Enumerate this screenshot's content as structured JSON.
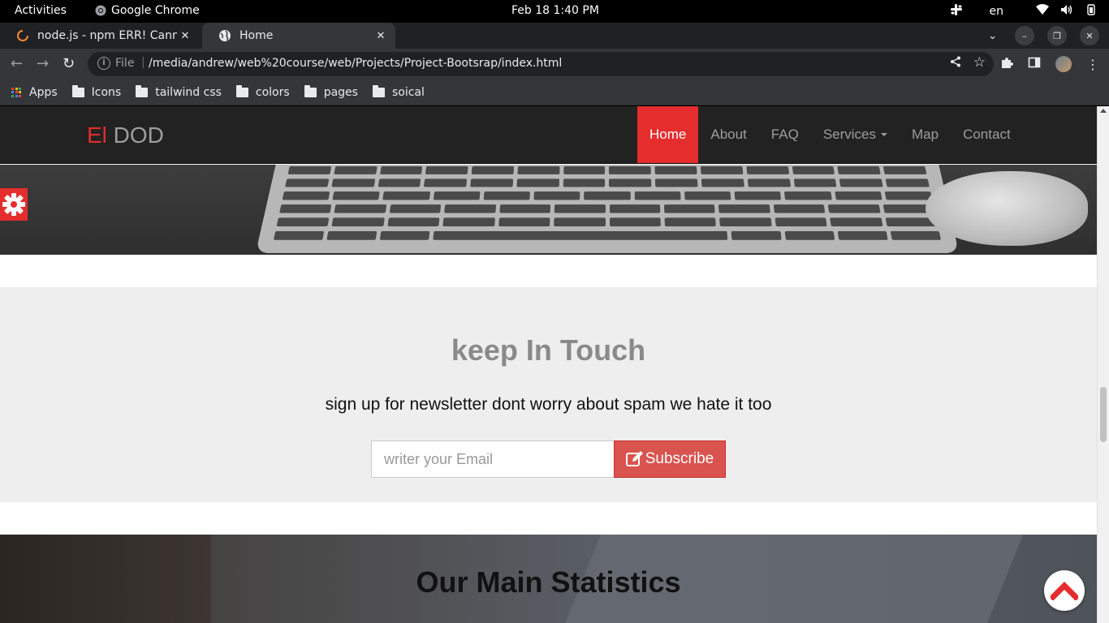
{
  "system": {
    "activities": "Activities",
    "app_name": "Google Chrome",
    "clock": "Feb 18  1:40 PM",
    "language": "en"
  },
  "browser": {
    "tabs": [
      {
        "title": "node.js - npm ERR! Cannot",
        "icon": "loading-spinner-icon",
        "active": false
      },
      {
        "title": "Home",
        "icon": "globe-icon",
        "active": true
      }
    ],
    "omnibox": {
      "scheme_label": "File",
      "url": "/media/andrew/web%20course/web/Projects/Project-Bootsrap/index.html"
    },
    "bookmarks": [
      {
        "label": "Apps",
        "icon": "apps-grid-icon"
      },
      {
        "label": "Icons",
        "icon": "folder-icon"
      },
      {
        "label": "tailwind css",
        "icon": "folder-icon"
      },
      {
        "label": "colors",
        "icon": "folder-icon"
      },
      {
        "label": "pages",
        "icon": "folder-icon"
      },
      {
        "label": "soical",
        "icon": "folder-icon"
      }
    ]
  },
  "site": {
    "brand_accent": "El",
    "brand_rest": " DOD",
    "nav": [
      {
        "label": "Home",
        "active": true
      },
      {
        "label": "About",
        "active": false
      },
      {
        "label": "FAQ",
        "active": false
      },
      {
        "label": "Services",
        "active": false,
        "dropdown": true
      },
      {
        "label": "Map",
        "active": false
      },
      {
        "label": "Contact",
        "active": false
      }
    ],
    "subscribe": {
      "heading": "keep In Touch",
      "text": "sign up for newsletter dont worry about spam we hate it too",
      "placeholder": "writer your Email",
      "button_label": "Subscribe"
    },
    "stats": {
      "heading": "Our Main Statistics"
    }
  },
  "colors": {
    "accent": "#e52d2d",
    "nav_bg": "#222222",
    "subscribe_bg": "#eeeeee",
    "button": "#d9534f"
  }
}
